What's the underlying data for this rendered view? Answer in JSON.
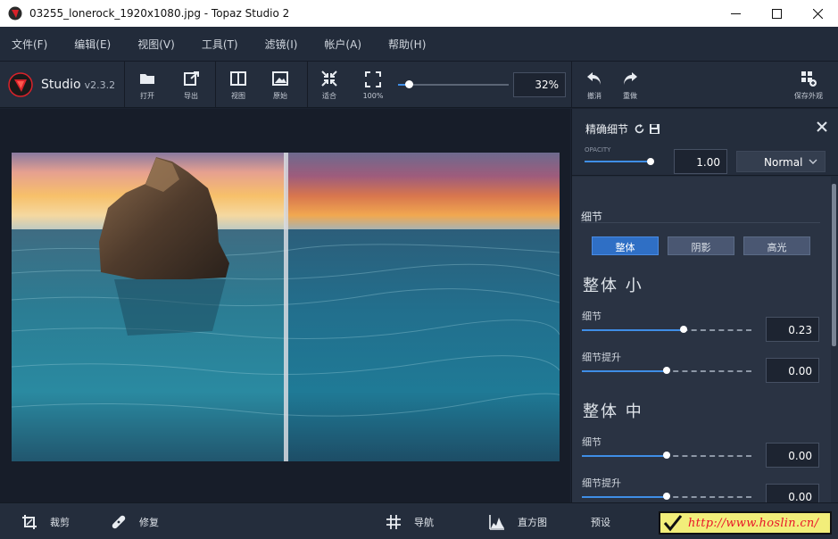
{
  "window": {
    "title": "03255_lonerock_1920x1080.jpg - Topaz Studio 2"
  },
  "menu": [
    "文件(F)",
    "编辑(E)",
    "视图(V)",
    "工具(T)",
    "滤镜(I)",
    "帐户(A)",
    "帮助(H)"
  ],
  "brand": {
    "name": "Studio",
    "version": "v2.3.2"
  },
  "toolbar": {
    "open": "打开",
    "export": "导出",
    "view": "视图",
    "original": "原始",
    "fit": "适合",
    "zoom100": "100%",
    "zoom_value": "32%",
    "zoom_level": 0.1,
    "undo": "撤消",
    "redo": "重做",
    "save_look": "保存外观"
  },
  "panel": {
    "title": "精确细节",
    "opacity_label": "OPACITY",
    "opacity_value": "1.00",
    "opacity_level": 1.0,
    "blend_mode": "Normal",
    "section": "细节",
    "tabs": [
      "整体",
      "阴影",
      "高光"
    ],
    "active_tab": 0,
    "groups": [
      {
        "heading": "整体 小",
        "controls": [
          {
            "label": "细节",
            "value": "0.23",
            "level": 0.6
          },
          {
            "label": "细节提升",
            "value": "0.00",
            "level": 0.5
          }
        ]
      },
      {
        "heading": "整体 中",
        "controls": [
          {
            "label": "细节",
            "value": "0.00",
            "level": 0.5
          },
          {
            "label": "细节提升",
            "value": "0.00",
            "level": 0.5
          }
        ]
      }
    ]
  },
  "bottombar": {
    "crop": "裁剪",
    "repair": "修复",
    "navigate": "导航",
    "histogram": "直方图",
    "presets": "预设"
  },
  "watermark": {
    "text": "http://www.hoslin.cn/"
  },
  "colors": {
    "accent": "#3f8ee6",
    "brand_red": "#d9222a"
  }
}
